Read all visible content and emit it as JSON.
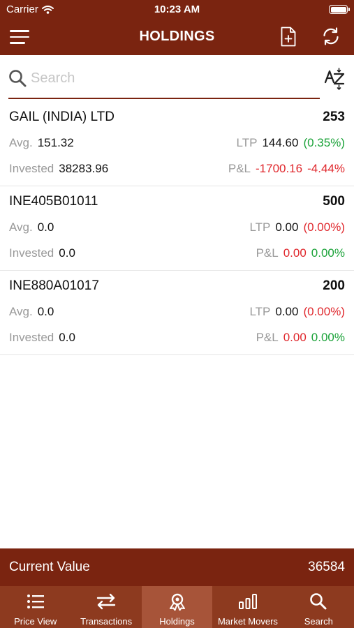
{
  "status_bar": {
    "carrier": "Carrier",
    "time": "10:23 AM"
  },
  "header": {
    "title": "HOLDINGS"
  },
  "search": {
    "placeholder": "Search",
    "value": ""
  },
  "labels": {
    "avg": "Avg.",
    "ltp": "LTP",
    "invested": "Invested",
    "pnl": "P&L"
  },
  "holdings": [
    {
      "name": "GAIL (INDIA) LTD",
      "qty": "253",
      "avg": "151.32",
      "ltp": "144.60",
      "ltp_change": "(0.35%)",
      "invested": "38283.96",
      "pnl": "-1700.16",
      "pnl_pct": "-4.44%"
    },
    {
      "name": "INE405B01011",
      "qty": "500",
      "avg": "0.0",
      "ltp": "0.00",
      "ltp_change": "(0.00%)",
      "invested": "0.0",
      "pnl": "0.00",
      "pnl_pct": "0.00%"
    },
    {
      "name": "INE880A01017",
      "qty": "200",
      "avg": "0.0",
      "ltp": "0.00",
      "ltp_change": "(0.00%)",
      "invested": "0.0",
      "pnl": "0.00",
      "pnl_pct": "0.00%"
    }
  ],
  "footer": {
    "label": "Current Value",
    "value": "36584"
  },
  "tabs": [
    {
      "label": "Price View",
      "icon": "list-icon"
    },
    {
      "label": "Transactions",
      "icon": "swap-arrows-icon"
    },
    {
      "label": "Holdings",
      "icon": "holdings-badge-icon",
      "active": true
    },
    {
      "label": "Market Movers",
      "icon": "bar-chart-icon"
    },
    {
      "label": "Search",
      "icon": "search-icon"
    }
  ],
  "colors": {
    "brand": "#7a2410",
    "tab_bar": "#8d3a1f",
    "tab_active": "#a75439",
    "gain": "#1ca33a",
    "loss": "#e0282d"
  }
}
